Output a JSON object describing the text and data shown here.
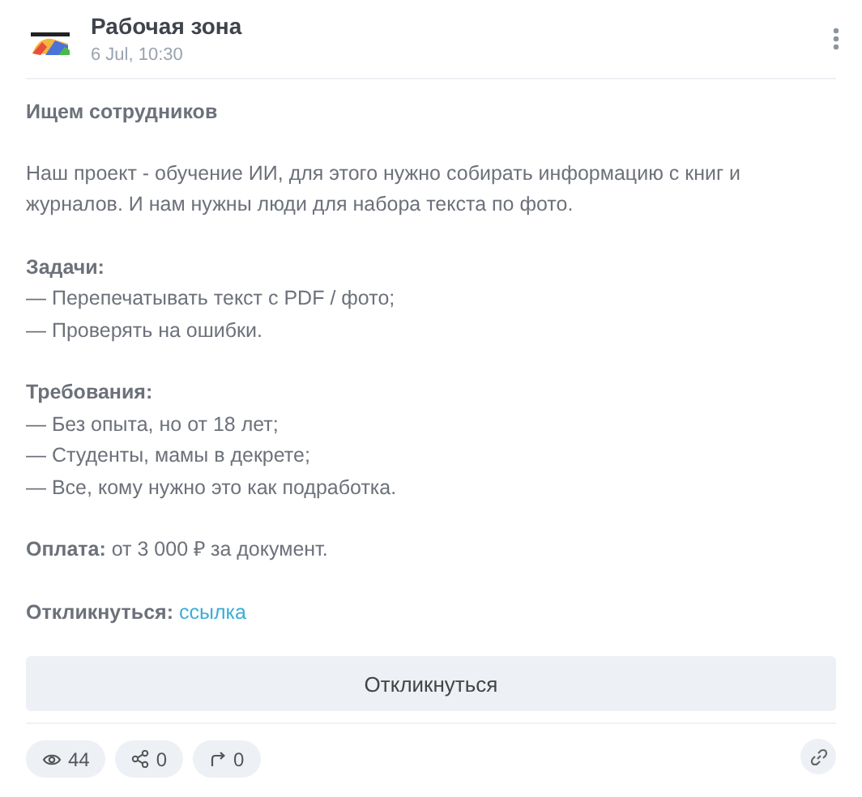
{
  "header": {
    "channel": "Рабочая зона",
    "date": "6 Jul, 10:30"
  },
  "post": {
    "heading": "Ищем сотрудников",
    "intro": "Наш проект - обучение ИИ, для этого нужно собирать информацию с книг и журналов. И нам нужны люди для набора текста по фото.",
    "sections": [
      {
        "title": "Задачи:",
        "items": [
          "— Перепечатывать текст с PDF / фото;",
          "— Проверять на ошибки."
        ]
      },
      {
        "title": "Требования:",
        "items": [
          "— Без опыта, но от 18 лет;",
          "— Студенты, мамы в декрете;",
          "— Все, кому нужно это как подработка."
        ]
      }
    ],
    "payment": {
      "label": "Оплата:",
      "value": "от 3 000 ₽ за документ."
    },
    "respond": {
      "label": "Откликнуться:",
      "link": "ссылка"
    }
  },
  "button": "Откликнуться",
  "stats": [
    {
      "kind": "views",
      "value": "44"
    },
    {
      "kind": "share",
      "value": "0"
    },
    {
      "kind": "forward",
      "value": "0"
    }
  ]
}
